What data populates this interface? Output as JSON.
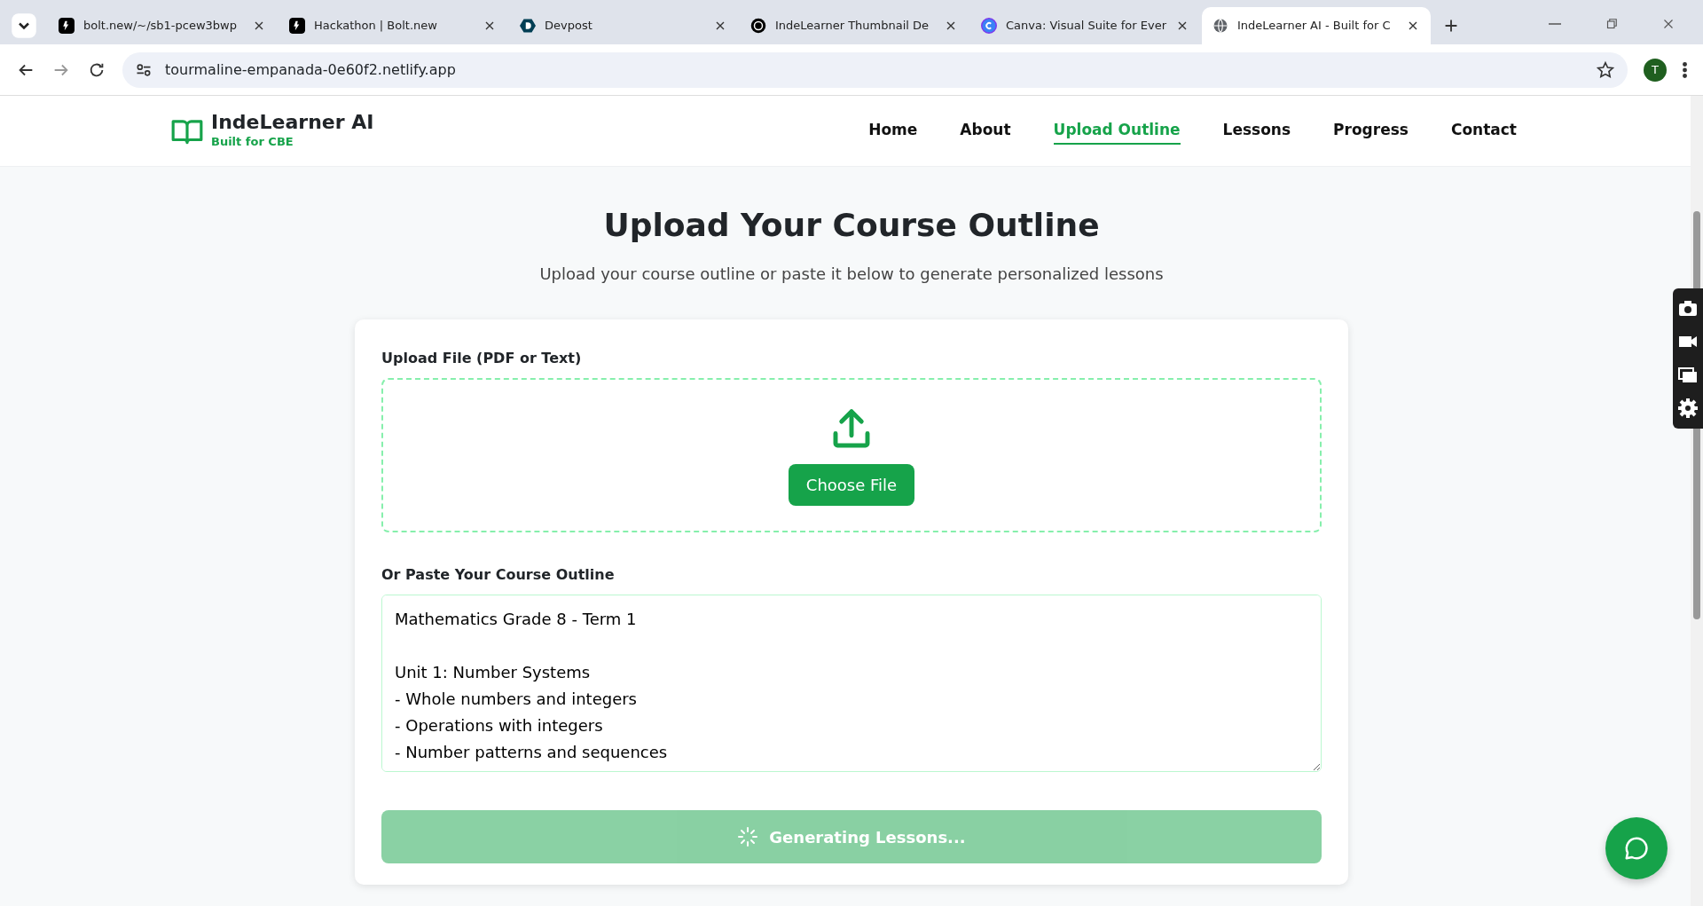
{
  "browser": {
    "tabs": [
      {
        "title": "bolt.new/~/sb1-pcew3bwp",
        "selected": false
      },
      {
        "title": "Hackathon | Bolt.new",
        "selected": false
      },
      {
        "title": "Devpost",
        "selected": false
      },
      {
        "title": "IndeLearner Thumbnail De",
        "selected": false
      },
      {
        "title": "Canva: Visual Suite for Ever",
        "selected": false
      },
      {
        "title": "IndeLearner AI - Built for C",
        "selected": true
      }
    ],
    "url": "tourmaline-empanada-0e60f2.netlify.app",
    "profile": "T"
  },
  "header": {
    "brand": "IndeLearner AI",
    "tagline": "Built for CBE",
    "nav": [
      {
        "label": "Home",
        "selected": false
      },
      {
        "label": "About",
        "selected": false
      },
      {
        "label": "Upload Outline",
        "selected": true
      },
      {
        "label": "Lessons",
        "selected": false
      },
      {
        "label": "Progress",
        "selected": false
      },
      {
        "label": "Contact",
        "selected": false
      }
    ]
  },
  "page": {
    "title": "Upload Your Course Outline",
    "subtitle": "Upload your course outline or paste it below to generate personalized lessons"
  },
  "upload": {
    "label": "Upload File (PDF or Text)",
    "button": "Choose File"
  },
  "outline": {
    "label": "Or Paste Your Course Outline",
    "value": "Mathematics Grade 8 - Term 1\n\nUnit 1: Number Systems\n- Whole numbers and integers\n- Operations with integers\n- Number patterns and sequences"
  },
  "generate": {
    "label": "Generating Lessons...",
    "disabled": true,
    "loading": true
  }
}
